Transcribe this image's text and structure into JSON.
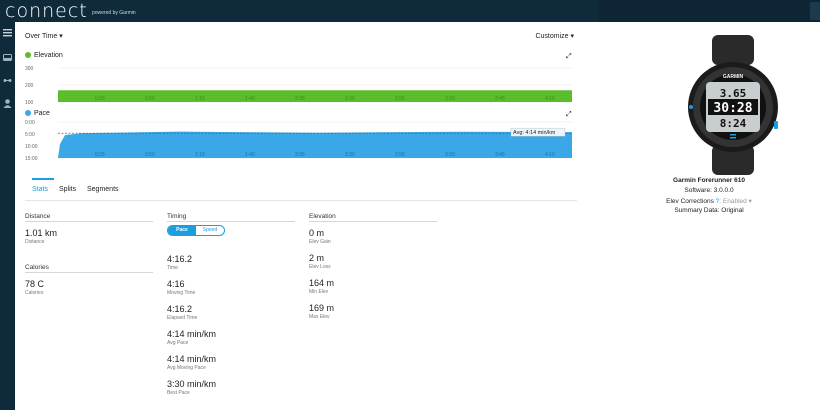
{
  "header": {
    "logo": "CONNECT",
    "logo_sub": "powered by Garmin"
  },
  "sidebar": {
    "items": [
      {
        "icon": "menu-icon"
      },
      {
        "icon": "inbox-icon"
      },
      {
        "icon": "workouts-icon"
      },
      {
        "icon": "user-icon"
      }
    ]
  },
  "controls": {
    "view_select": "Over Time ▾",
    "customize": "Customize ▾"
  },
  "elevation_chart": {
    "title": "Elevation",
    "color": "#5bbd2b",
    "y_ticks": [
      "300",
      "200",
      "100"
    ],
    "x_ticks": [
      "0:25",
      "0:50",
      "1:15",
      "1:40",
      "2:05",
      "2:30",
      "2:55",
      "3:20",
      "3:45",
      "4:10"
    ],
    "ylim": [
      100,
      300
    ],
    "fill_value": 169
  },
  "pace_chart": {
    "title": "Pace",
    "color": "#3aa7e8",
    "y_ticks": [
      "0:00",
      "5:00",
      "10:00",
      "15:00"
    ],
    "x_ticks": [
      "0:25",
      "0:50",
      "1:15",
      "1:40",
      "2:05",
      "2:30",
      "2:55",
      "3:20",
      "3:45",
      "4:10"
    ],
    "avg_label": "Avg: 4:14 min/km"
  },
  "tabs": [
    "Stats",
    "Splits",
    "Segments"
  ],
  "stats": {
    "distance": {
      "head": "Distance",
      "value": "1.01 km",
      "label": "Distance"
    },
    "calories": {
      "head": "Calories",
      "value": "78 C",
      "label": "Calories"
    },
    "timing": {
      "head": "Timing",
      "toggle": [
        "Pace",
        "Speed"
      ],
      "rows": [
        {
          "value": "4:16.2",
          "label": "Time"
        },
        {
          "value": "4:16",
          "label": "Moving Time"
        },
        {
          "value": "4:16.2",
          "label": "Elapsed Time"
        },
        {
          "value": "4:14 min/km",
          "label": "Avg Pace"
        },
        {
          "value": "4:14 min/km",
          "label": "Avg Moving Pace"
        },
        {
          "value": "3:30 min/km",
          "label": "Best Pace"
        }
      ]
    },
    "elevation": {
      "head": "Elevation",
      "rows": [
        {
          "value": "0 m",
          "label": "Elev Gain"
        },
        {
          "value": "2 m",
          "label": "Elev Loss"
        },
        {
          "value": "164 m",
          "label": "Min Elev"
        },
        {
          "value": "169 m",
          "label": "Max Elev"
        }
      ]
    }
  },
  "device": {
    "name": "Garmin Forerunner 610",
    "software": "Software: 3.0.0.0",
    "elev_corrections": "Elev Corrections",
    "help": "?",
    "enabled": ": Enabled ▾",
    "summary": "Summary Data: Original",
    "watch_brand": "GARMIN",
    "watch_line1": "3.65",
    "watch_line2": "30:28",
    "watch_line3": "8:24"
  }
}
